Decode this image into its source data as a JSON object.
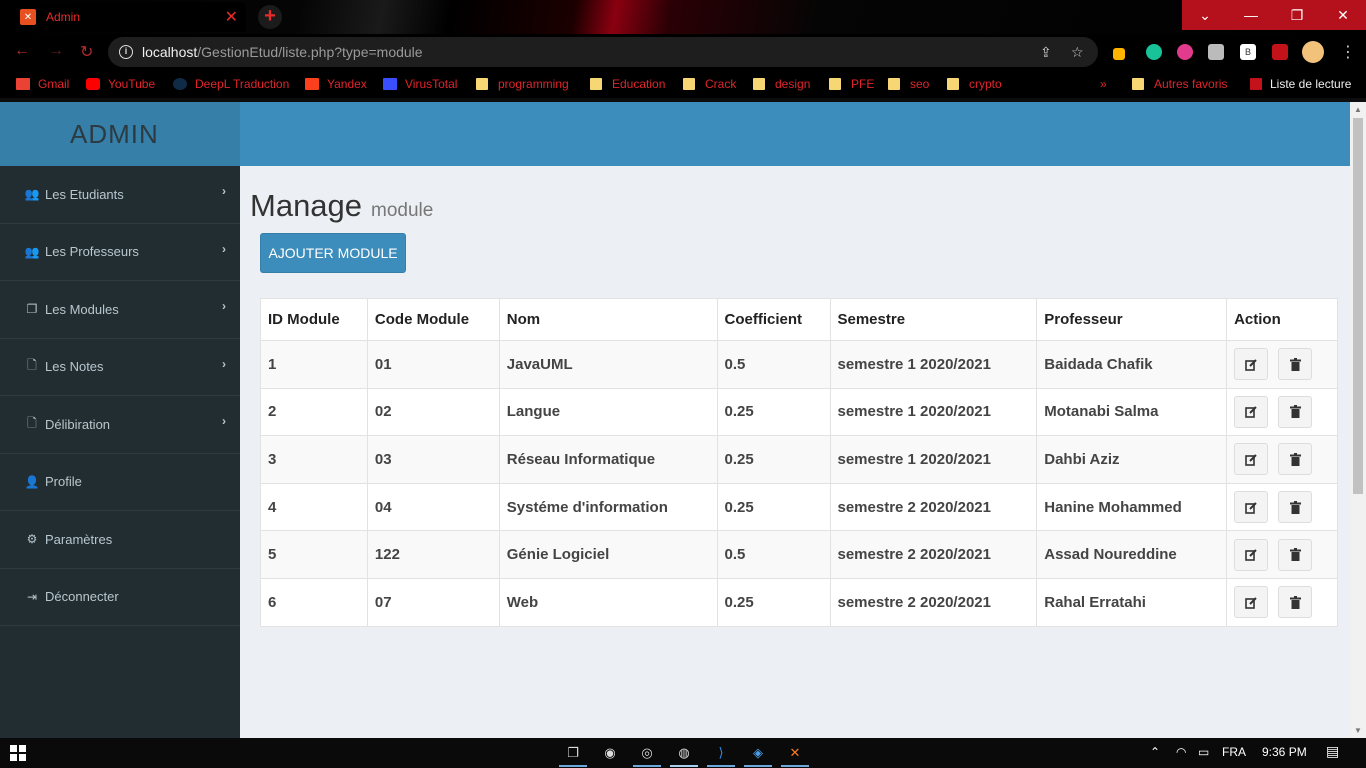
{
  "browser": {
    "tab_title": "Admin",
    "url_host": "localhost",
    "url_path": "/GestionEtud/liste.php?type=module",
    "bookmarks": [
      {
        "label": "Gmail",
        "icon": "gmail-icon"
      },
      {
        "label": "YouTube",
        "icon": "youtube-icon"
      },
      {
        "label": "DeepL Traduction",
        "icon": "deepl-icon"
      },
      {
        "label": "Yandex",
        "icon": "yandex-icon"
      },
      {
        "label": "VirusTotal",
        "icon": "virustotal-icon"
      },
      {
        "label": "programming",
        "icon": "folder-icon"
      },
      {
        "label": "Education",
        "icon": "folder-icon"
      },
      {
        "label": "Crack",
        "icon": "folder-icon"
      },
      {
        "label": "design",
        "icon": "folder-icon"
      },
      {
        "label": "PFE",
        "icon": "folder-icon"
      },
      {
        "label": "seo",
        "icon": "folder-icon"
      },
      {
        "label": "crypto",
        "icon": "folder-icon"
      }
    ],
    "more_bookmarks": "»",
    "other_bookmarks": "Autres favoris",
    "reading_list": "Liste de lecture"
  },
  "app": {
    "logo": "ADMIN",
    "sidebar": [
      {
        "label": "Les Etudiants",
        "icon": "users-icon",
        "chevron": true
      },
      {
        "label": "Les Professeurs",
        "icon": "users-icon",
        "chevron": true
      },
      {
        "label": "Les Modules",
        "icon": "copy-icon",
        "chevron": true
      },
      {
        "label": "Les Notes",
        "icon": "file-icon",
        "chevron": true
      },
      {
        "label": "Délibiration",
        "icon": "file-icon",
        "chevron": true
      },
      {
        "label": "Profile",
        "icon": "user-icon",
        "chevron": false
      },
      {
        "label": "Paramètres",
        "icon": "gears-icon",
        "chevron": false
      },
      {
        "label": "Déconnecter",
        "icon": "sign-out-icon",
        "chevron": false
      }
    ],
    "page_title": "Manage",
    "page_subtitle": "module",
    "add_button": "AJOUTER MODULE",
    "table": {
      "headers": [
        "ID Module",
        "Code Module",
        "Nom",
        "Coefficient",
        "Semestre",
        "Professeur",
        "Action"
      ],
      "rows": [
        [
          "1",
          "01",
          "JavaUML",
          "0.5",
          "semestre 1 2020/2021",
          "Baidada Chafik"
        ],
        [
          "2",
          "02",
          "Langue",
          "0.25",
          "semestre 1 2020/2021",
          "Motanabi Salma"
        ],
        [
          "3",
          "03",
          "Réseau Informatique",
          "0.25",
          "semestre 1 2020/2021",
          "Dahbi Aziz"
        ],
        [
          "4",
          "04",
          "Systéme d'information",
          "0.25",
          "semestre 2 2020/2021",
          "Hanine Mohammed"
        ],
        [
          "5",
          "122",
          "Génie Logiciel",
          "0.5",
          "semestre 2 2020/2021",
          "Assad Noureddine"
        ],
        [
          "6",
          "07",
          "Web",
          "0.25",
          "semestre 2 2020/2021",
          "Rahal Erratahi"
        ]
      ]
    }
  },
  "taskbar": {
    "language": "FRA",
    "time": "9:36 PM"
  },
  "colors": {
    "header": "#3c8dbc",
    "logo_bg": "#367fa9",
    "sidebar": "#222d32",
    "accent_red": "#e0252b"
  }
}
